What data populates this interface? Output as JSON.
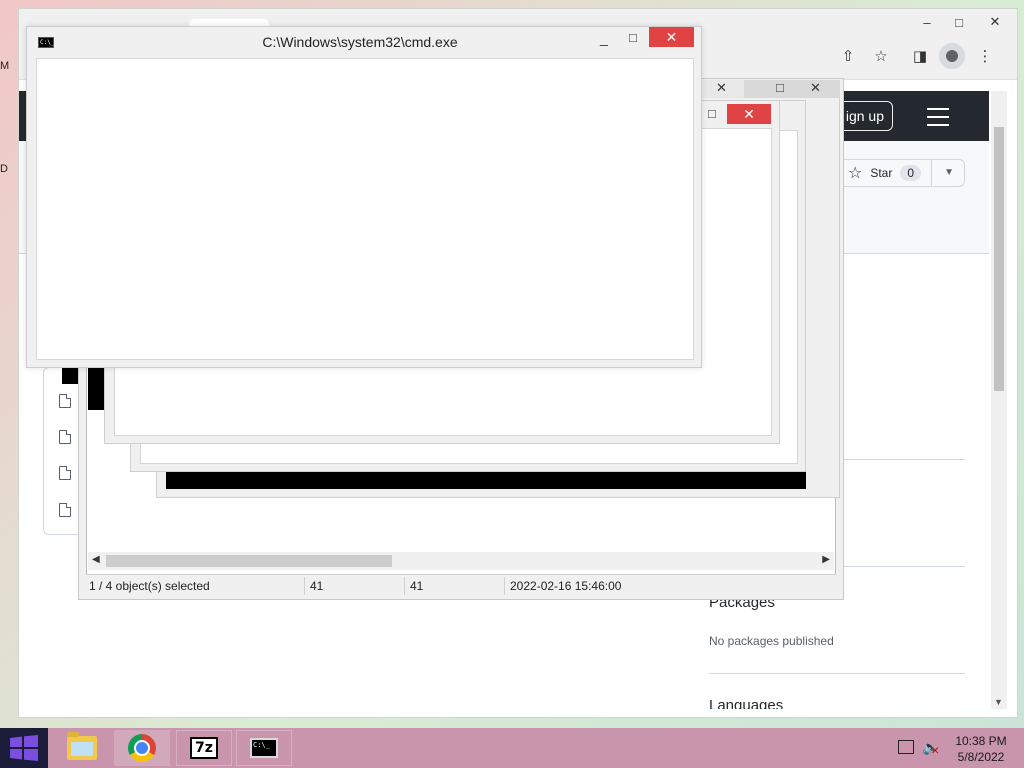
{
  "browser": {
    "controls": {
      "minimize": "–",
      "maximize": "□",
      "close": "✕"
    },
    "toolbar_icons": [
      "share-icon",
      "star-icon",
      "side-panel-icon",
      "profile-icon",
      "menu-kebab-icon"
    ],
    "github": {
      "signup_label": "ign up",
      "star_label": "Star",
      "star_count": "0",
      "packages_heading": "Packages",
      "packages_text": "No packages published",
      "languages_heading": "Languages"
    }
  },
  "zip_window": {
    "status": {
      "selection": "1 / 4 object(s) selected",
      "size": "41",
      "packed": "41",
      "modified": "2022-02-16 15:46:00"
    }
  },
  "cmd_window": {
    "title": "C:\\Windows\\system32\\cmd.exe",
    "icon_text": "C:\\_"
  },
  "taskbar": {
    "apps": [
      "file-explorer",
      "chrome",
      "7-zip",
      "command-prompt"
    ],
    "sevenz_label": "7z",
    "cmd_label": "C:\\_",
    "clock_time": "10:38 PM",
    "clock_date": "5/8/2022"
  },
  "desktop": {
    "edge_letters": [
      "M",
      "D"
    ]
  },
  "colors": {
    "close_red": "#e04343",
    "github_header": "#24292f",
    "taskbar": "#c995ad",
    "start": "#1b1b3a"
  }
}
